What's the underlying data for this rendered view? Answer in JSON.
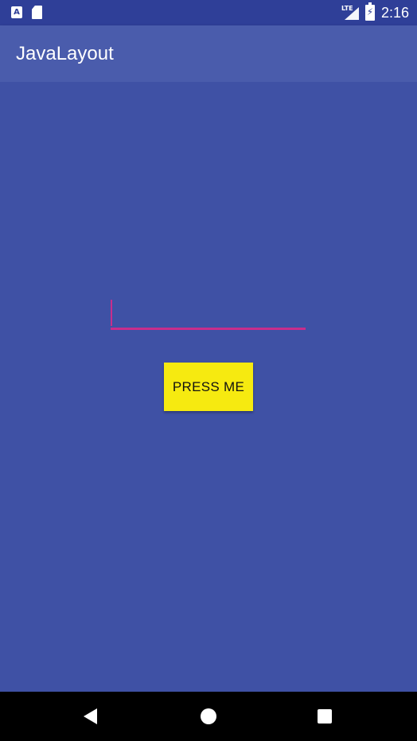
{
  "status_bar": {
    "time": "2:16",
    "network_label": "LTE",
    "icons": [
      "notification-a-icon",
      "sd-card-icon",
      "lte-signal-icon",
      "battery-charging-icon"
    ]
  },
  "app_bar": {
    "title": "JavaLayout"
  },
  "main": {
    "text_field": {
      "value": "",
      "placeholder": ""
    },
    "button_label": "PRESS ME"
  },
  "nav_bar": {
    "icons": [
      "back-icon",
      "home-icon",
      "recents-icon"
    ]
  },
  "colors": {
    "primary": "#4a5cac",
    "primary_dark": "#2f3f98",
    "background": "#3f51a5",
    "accent": "#c82d8c",
    "button": "#f6ea10"
  }
}
